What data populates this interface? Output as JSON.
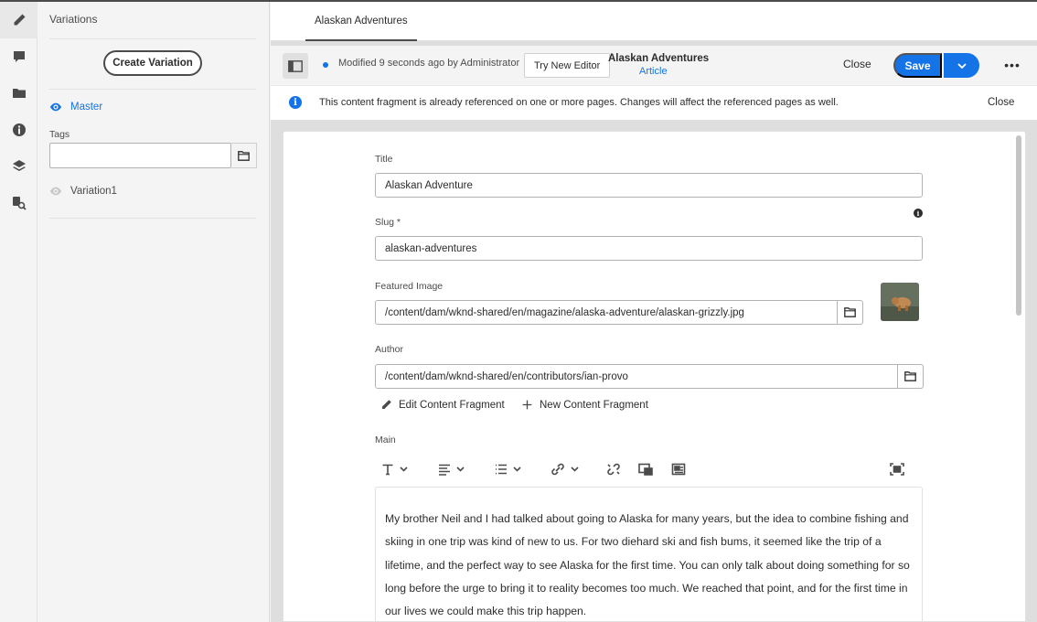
{
  "variations_panel": {
    "title": "Variations",
    "create_label": "Create Variation",
    "master_label": "Master",
    "tags_label": "Tags",
    "tags_value": "",
    "variation_1": "Variation1"
  },
  "tab": {
    "label": "Alaskan Adventures"
  },
  "action_bar": {
    "status": "Modified 9 seconds ago by Administrator",
    "try_new_editor": "Try New Editor",
    "fragment_title": "Alaskan Adventures",
    "fragment_model": "Article",
    "close": "Close",
    "save": "Save",
    "more": "•••"
  },
  "info_bar": {
    "message": "This content fragment is already referenced on one or more pages. Changes will affect the referenced pages as well.",
    "close": "Close"
  },
  "form": {
    "title_label": "Title",
    "title_value": "Alaskan Adventure",
    "slug_label": "Slug *",
    "slug_value": "alaskan-adventures",
    "image_label": "Featured Image",
    "image_value": "/content/dam/wknd-shared/en/magazine/alaska-adventure/alaskan-grizzly.jpg",
    "author_label": "Author",
    "author_value": "/content/dam/wknd-shared/en/contributors/ian-provo",
    "edit_fragment": "Edit Content Fragment",
    "new_fragment": "New Content Fragment",
    "main_label": "Main",
    "main_text": "My brother Neil and I had talked about going to Alaska for many years, but the idea to combine fishing and skiing in one trip was kind of new to us. For two diehard ski and fish bums, it seemed like the trip of a lifetime, and the perfect way to see Alaska for the first time. You can only talk about doing something for so long before the urge to bring it to reality becomes too much. We reached that point, and for the first time in our lives we could make this trip happen."
  },
  "colors": {
    "accent": "#1473e6",
    "text": "#2c2c2c",
    "panel_bg": "#f4f4f4",
    "main_bg": "#dedede"
  },
  "icons": {
    "rail": [
      "pencil-icon",
      "comment-icon",
      "folder-icon",
      "info-icon",
      "layers-icon",
      "search-references-icon"
    ],
    "rte": [
      "text-format-icon",
      "align-icon",
      "list-icon",
      "link-icon",
      "unlink-icon",
      "insert-image-icon",
      "insert-fragment-icon",
      "fullscreen-icon"
    ]
  }
}
